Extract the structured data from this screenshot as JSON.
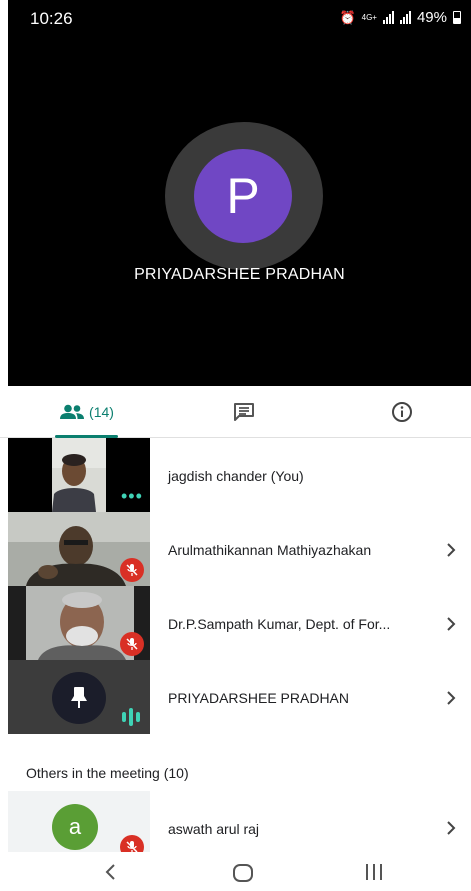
{
  "status_bar": {
    "time": "10:26",
    "network": "4G+",
    "battery": "49%"
  },
  "presenter": {
    "initial": "P",
    "name": "PRIYADARSHEE PRADHAN"
  },
  "tabs": {
    "people_count": "(14)"
  },
  "participants": [
    {
      "name": "jagdish chander (You)"
    },
    {
      "name": "Arulmathikannan Mathiyazhakan"
    },
    {
      "name": "Dr.P.Sampath Kumar, Dept. of For..."
    },
    {
      "name": "PRIYADARSHEE PRADHAN"
    }
  ],
  "others": {
    "title": "Others in the meeting (10)",
    "items": [
      {
        "initial": "a",
        "name": "aswath arul raj"
      }
    ]
  },
  "colors": {
    "accent": "#0b7f6f",
    "avatar_purple": "#7047c4",
    "avatar_green": "#5a9e35",
    "mute_red": "#d93025"
  }
}
